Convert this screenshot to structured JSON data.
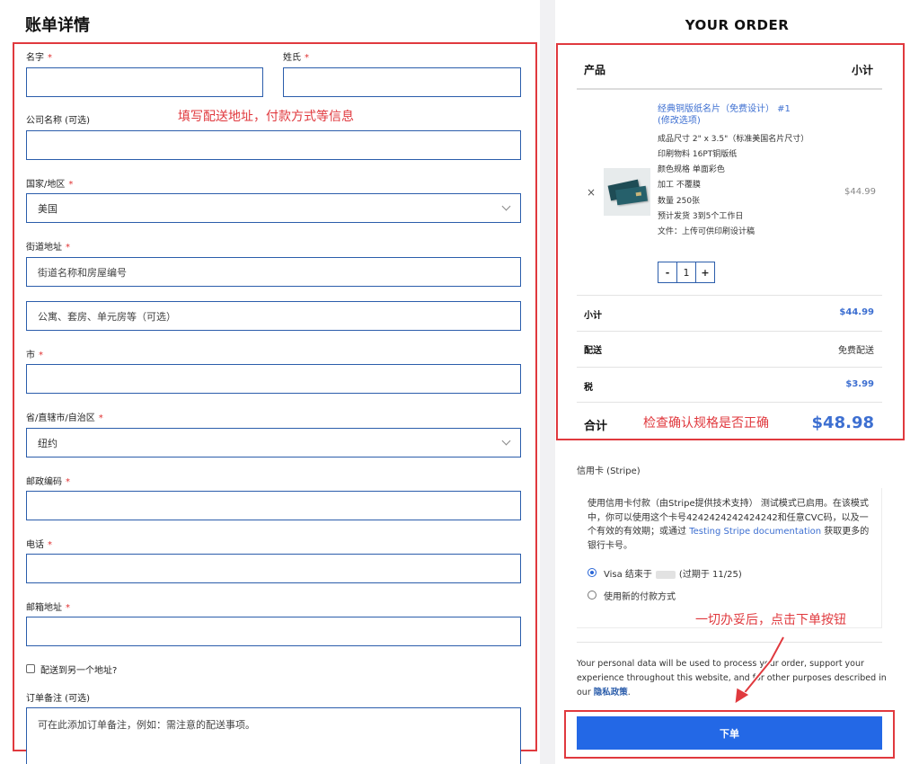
{
  "billing": {
    "title": "账单详情",
    "first_name_label": "名字",
    "last_name_label": "姓氏",
    "company_label": "公司名称 (可选)",
    "country_label": "国家/地区",
    "country_value": "美国",
    "street_label": "街道地址",
    "street_placeholder": "街道名称和房屋编号",
    "apartment_placeholder": "公寓、套房、单元房等（可选）",
    "city_label": "市",
    "state_label": "省/直辖市/自治区",
    "state_value": "纽约",
    "zip_label": "邮政编码",
    "phone_label": "电话",
    "email_label": "邮箱地址",
    "ship_different_label": "配送到另一个地址?",
    "notes_label": "订单备注 (可选)",
    "notes_placeholder": "可在此添加订单备注，例如：需注意的配送事项。",
    "required_mark": "*"
  },
  "annotations": {
    "fill_info": "填写配送地址，付款方式等信息",
    "check_spec": "检查确认规格是否正确",
    "place_order_hint": "一切办妥后，点击下单按钮"
  },
  "order": {
    "title": "YOUR ORDER",
    "col_product": "产品",
    "col_subtotal": "小计",
    "product": {
      "name": "经典铜版纸名片（免费设计） #1",
      "edit_link": "(修改选项)",
      "specs": [
        "成品尺寸  2\" x 3.5\"（标准美国名片尺寸）",
        "印刷物料  16PT铜版纸",
        "颜色规格  单面彩色",
        "加工  不覆膜",
        "数量  250张",
        "预计发货  3到5个工作日",
        "文件：上传可供印刷设计稿"
      ],
      "price": "$44.99",
      "remove": "×",
      "quantity": "1",
      "minus": "-",
      "plus": "+"
    },
    "subtotal_label": "小计",
    "subtotal_value": "$44.99",
    "shipping_label": "配送",
    "shipping_value": "免费配送",
    "tax_label": "税",
    "tax_value": "$3.99",
    "total_label": "合计",
    "total_value": "$48.98"
  },
  "payment": {
    "method_title": "信用卡 (Stripe)",
    "desc_part1": "使用信用卡付款（由Stripe提供技术支持） 测试模式已启用。在该模式中，你可以使用这个卡号4242424242424242和任意CVC码，以及一个有效的有效期；或通过 ",
    "desc_link": "Testing Stripe documentation",
    "desc_part2": " 获取更多的银行卡号。",
    "saved_card_prefix": "Visa 结束于",
    "saved_card_suffix": "(过期于 11/25)",
    "new_method_label": "使用新的付款方式"
  },
  "privacy": {
    "text": "Your personal data will be used to process your order, support your experience throughout this website, and for other purposes described in our ",
    "link": "隐私政策",
    "end": "."
  },
  "place_order_label": "下单",
  "colors": {
    "accent": "#2368e6",
    "annotation": "#e0393e",
    "link": "#3d6fd1",
    "input_border": "#2b5dab"
  }
}
